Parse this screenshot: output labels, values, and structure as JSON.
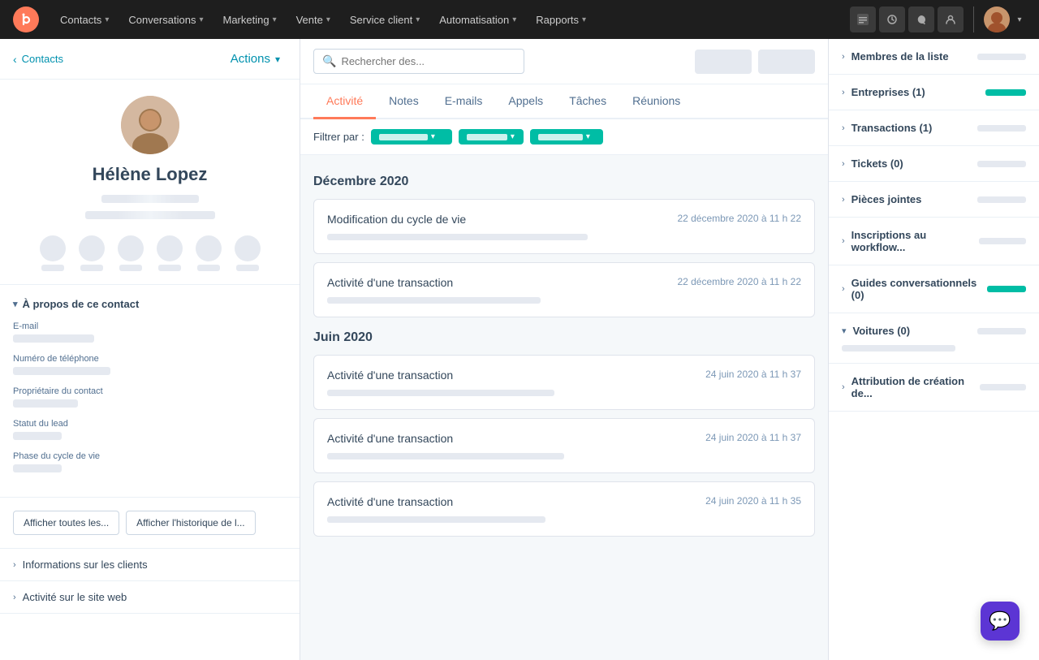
{
  "topnav": {
    "items": [
      {
        "label": "Contacts",
        "id": "contacts"
      },
      {
        "label": "Conversations",
        "id": "conversations"
      },
      {
        "label": "Marketing",
        "id": "marketing"
      },
      {
        "label": "Vente",
        "id": "vente"
      },
      {
        "label": "Service client",
        "id": "service"
      },
      {
        "label": "Automatisation",
        "id": "automatisation"
      },
      {
        "label": "Rapports",
        "id": "rapports"
      }
    ]
  },
  "breadcrumb": {
    "back_label": "Contacts",
    "actions_label": "Actions"
  },
  "contact": {
    "name": "Hélène Lopez"
  },
  "left_sections": [
    {
      "label": "À propos de ce contact",
      "expanded": true
    },
    {
      "label": "Informations sur les clients",
      "expanded": false
    },
    {
      "label": "Activité sur le site web",
      "expanded": false
    }
  ],
  "fields": [
    {
      "label": "E-mail"
    },
    {
      "label": "Numéro de téléphone"
    },
    {
      "label": "Propriétaire du contact"
    },
    {
      "label": "Statut du lead"
    },
    {
      "label": "Phase du cycle de vie"
    }
  ],
  "buttons": [
    {
      "label": "Afficher toutes les..."
    },
    {
      "label": "Afficher l'historique de l..."
    }
  ],
  "search": {
    "placeholder": "Rechercher des..."
  },
  "tabs": [
    {
      "label": "Activité",
      "active": true
    },
    {
      "label": "Notes"
    },
    {
      "label": "E-mails"
    },
    {
      "label": "Appels"
    },
    {
      "label": "Tâches"
    },
    {
      "label": "Réunions"
    }
  ],
  "filter": {
    "label": "Filtrer par :"
  },
  "months": [
    {
      "label": "Décembre 2020",
      "activities": [
        {
          "title": "Modification du cycle de vie",
          "date": "22 décembre 2020 à 11 h 22",
          "skel_width": "55%"
        },
        {
          "title": "Activité d'une transaction",
          "date": "22 décembre 2020 à 11 h 22",
          "skel_width": "45%"
        }
      ]
    },
    {
      "label": "Juin 2020",
      "activities": [
        {
          "title": "Activité d'une transaction",
          "date": "24 juin 2020 à 11 h 37",
          "skel_width": "48%"
        },
        {
          "title": "Activité d'une transaction",
          "date": "24 juin 2020 à 11 h 37",
          "skel_width": "50%"
        },
        {
          "title": "Activité d'une transaction",
          "date": "24 juin 2020 à 11 h 35",
          "skel_width": "46%"
        }
      ]
    }
  ],
  "right_sections": [
    {
      "label": "Membres de la liste",
      "skel_color": "gray",
      "expanded": false
    },
    {
      "label": "Entreprises (1)",
      "skel_color": "green",
      "expanded": false
    },
    {
      "label": "Transactions (1)",
      "skel_color": "gray",
      "expanded": false
    },
    {
      "label": "Tickets (0)",
      "skel_color": "gray",
      "expanded": false
    },
    {
      "label": "Pièces jointes",
      "skel_color": "gray",
      "expanded": false
    },
    {
      "label": "Inscriptions au workflow...",
      "skel_color": "gray",
      "expanded": false
    },
    {
      "label": "Guides conversationnels (0)",
      "skel_color": "green",
      "expanded": false
    },
    {
      "label": "Voitures (0)",
      "skel_color": "gray",
      "expanded": true
    },
    {
      "label": "Attribution de création de...",
      "skel_color": "gray",
      "expanded": false
    }
  ]
}
